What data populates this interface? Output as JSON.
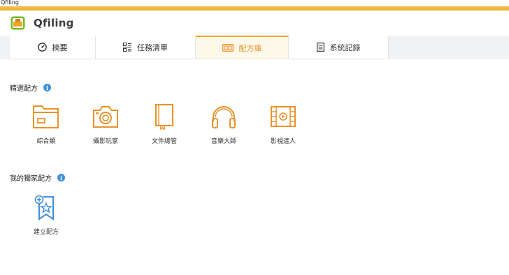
{
  "window": {
    "title": "Qfiling"
  },
  "app": {
    "name": "Qfiling"
  },
  "tabs": [
    {
      "label": "摘要",
      "icon": "dashboard-icon"
    },
    {
      "label": "任務清單",
      "icon": "task-list-icon"
    },
    {
      "label": "配方庫",
      "icon": "recipe-library-icon",
      "active": true
    },
    {
      "label": "系統記錄",
      "icon": "document-icon"
    }
  ],
  "featured": {
    "title": "精選配方",
    "items": [
      {
        "label": "綜合類",
        "icon": "folder-icon"
      },
      {
        "label": "攝影玩家",
        "icon": "camera-icon"
      },
      {
        "label": "文件總管",
        "icon": "book-icon"
      },
      {
        "label": "音樂大師",
        "icon": "headphones-icon"
      },
      {
        "label": "影視達人",
        "icon": "film-icon"
      }
    ]
  },
  "mine": {
    "title": "我的獨家配方",
    "items": [
      {
        "label": "建立配方",
        "icon": "add-bookmark-icon"
      }
    ]
  },
  "colors": {
    "accent": "#f0a823",
    "icon_orange": "#e8932a",
    "info_blue": "#3f8fdc"
  }
}
